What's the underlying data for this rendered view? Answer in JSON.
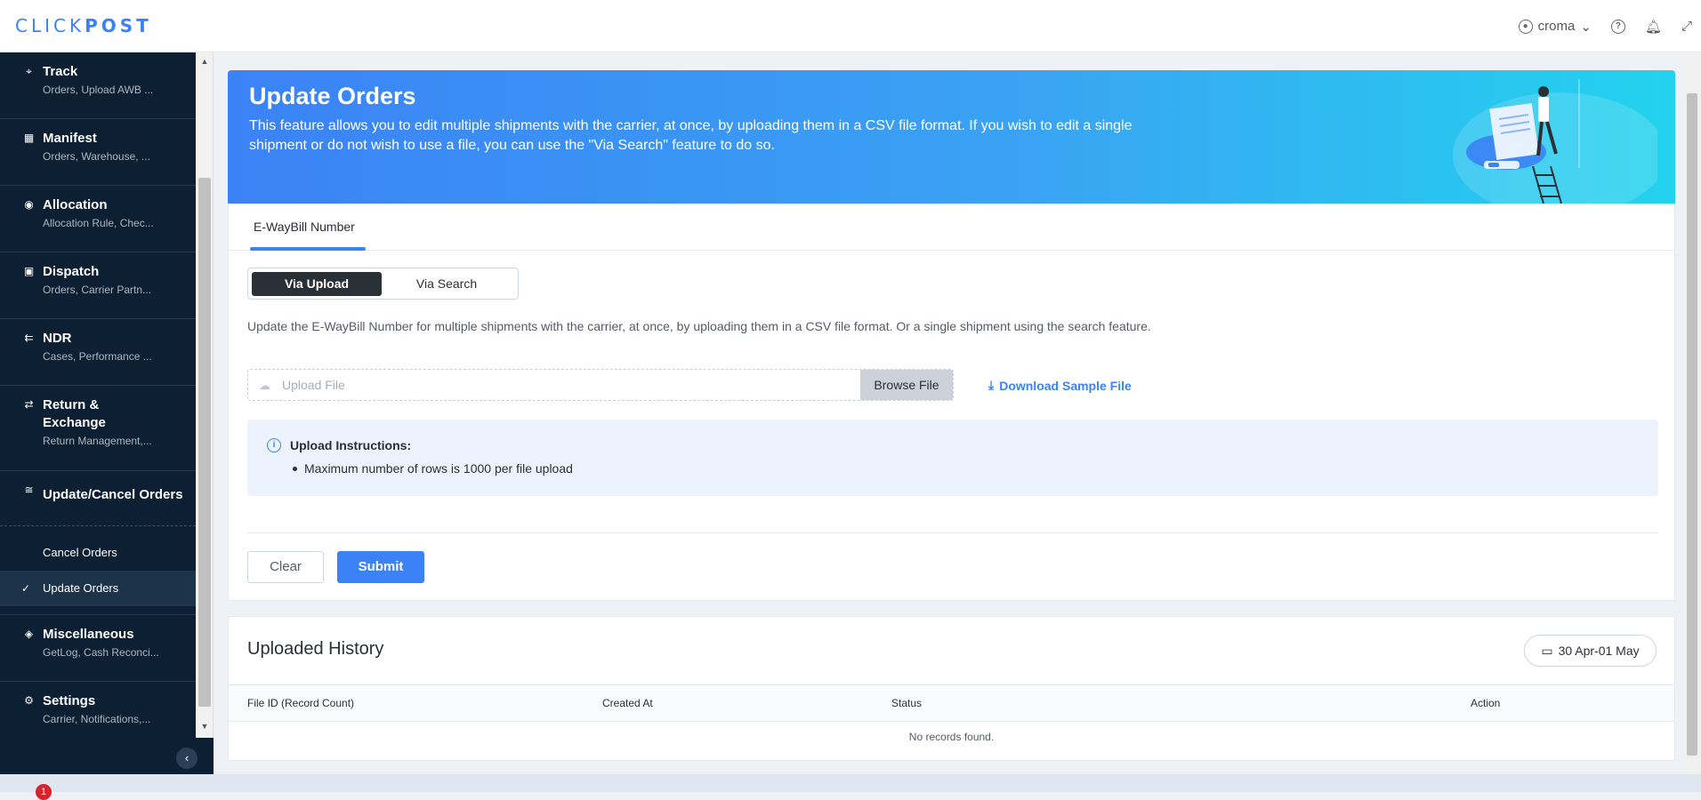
{
  "brand": {
    "name_light": "CLICK",
    "name_bold": "POST"
  },
  "header": {
    "user": "croma"
  },
  "sidebar": {
    "items": [
      {
        "title": "Track",
        "sub": "Orders, Upload AWB ..."
      },
      {
        "title": "Manifest",
        "sub": "Orders, Warehouse, ..."
      },
      {
        "title": "Allocation",
        "sub": "Allocation Rule, Chec..."
      },
      {
        "title": "Dispatch",
        "sub": "Orders, Carrier Partn..."
      },
      {
        "title": "NDR",
        "sub": "Cases, Performance ..."
      },
      {
        "title": "Return & Exchange",
        "sub": "Return Management,..."
      },
      {
        "title": "Update/Cancel Orders",
        "sub": ""
      },
      {
        "title": "Miscellaneous",
        "sub": "GetLog, Cash Reconci..."
      },
      {
        "title": "Settings",
        "sub": "Carrier, Notifications,..."
      }
    ],
    "sub_items": [
      "Cancel Orders",
      "Update Orders"
    ]
  },
  "banner": {
    "title": "Update Orders",
    "text": "This feature allows you to edit multiple shipments with the carrier, at once, by uploading them in a CSV file format. If you wish to edit a single shipment or do not wish to use a file, you can use the \"Via Search\" feature to do so."
  },
  "tabs": [
    "E-WayBill Number"
  ],
  "mode": {
    "upload": "Via Upload",
    "search": "Via Search"
  },
  "description": "Update the E-WayBill Number for multiple shipments with the carrier, at once, by uploading them in a CSV file format. Or a single shipment using the search feature.",
  "upload": {
    "placeholder": "Upload File",
    "browse": "Browse File",
    "download": "Download Sample File"
  },
  "instructions": {
    "title": "Upload Instructions:",
    "items": [
      "Maximum number of rows is 1000 per file upload"
    ]
  },
  "actions": {
    "clear": "Clear",
    "submit": "Submit"
  },
  "history": {
    "title": "Uploaded History",
    "date_range": "30 Apr-01 May",
    "columns": [
      "File ID (Record Count)",
      "Created At",
      "Status",
      "Action"
    ],
    "empty": "No records found."
  },
  "taskbar": {
    "badge": "1"
  }
}
